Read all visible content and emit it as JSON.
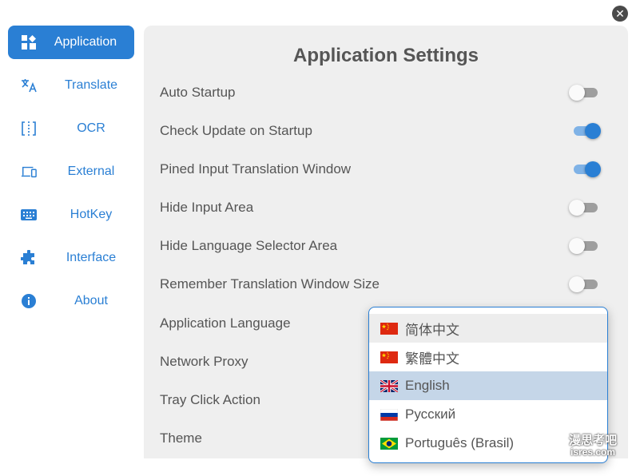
{
  "window": {
    "close_icon": "close-icon"
  },
  "sidebar": {
    "items": [
      {
        "label": "Application",
        "icon": "dashboard-icon",
        "active": true
      },
      {
        "label": "Translate",
        "icon": "translate-icon",
        "active": false
      },
      {
        "label": "OCR",
        "icon": "ocr-icon",
        "active": false
      },
      {
        "label": "External",
        "icon": "devices-icon",
        "active": false
      },
      {
        "label": "HotKey",
        "icon": "keyboard-icon",
        "active": false
      },
      {
        "label": "Interface",
        "icon": "puzzle-icon",
        "active": false
      },
      {
        "label": "About",
        "icon": "info-icon",
        "active": false
      }
    ]
  },
  "settings": {
    "title": "Application Settings",
    "toggles": [
      {
        "label": "Auto Startup",
        "on": false
      },
      {
        "label": "Check Update on Startup",
        "on": true
      },
      {
        "label": "Pined Input Translation Window",
        "on": true
      },
      {
        "label": "Hide Input Area",
        "on": false
      },
      {
        "label": "Hide Language Selector Area",
        "on": false
      },
      {
        "label": "Remember Translation Window Size",
        "on": false
      }
    ],
    "selects": [
      {
        "label": "Application Language"
      },
      {
        "label": "Network Proxy"
      },
      {
        "label": "Tray Click Action"
      },
      {
        "label": "Theme"
      }
    ]
  },
  "language_dropdown": {
    "options": [
      {
        "label": "简体中文",
        "flag": "cn-flag",
        "state": "hover"
      },
      {
        "label": "繁體中文",
        "flag": "cn-flag",
        "state": ""
      },
      {
        "label": "English",
        "flag": "gb-flag",
        "state": "selected"
      },
      {
        "label": "Русский",
        "flag": "ru-flag",
        "state": ""
      },
      {
        "label": "Português (Brasil)",
        "flag": "br-flag",
        "state": ""
      }
    ]
  },
  "watermark": {
    "line1": "漫思考吧",
    "line2": "isres.com"
  },
  "colors": {
    "accent": "#2a7fd4",
    "panel_bg": "#efefef",
    "selected_bg": "#c5d6e8"
  }
}
